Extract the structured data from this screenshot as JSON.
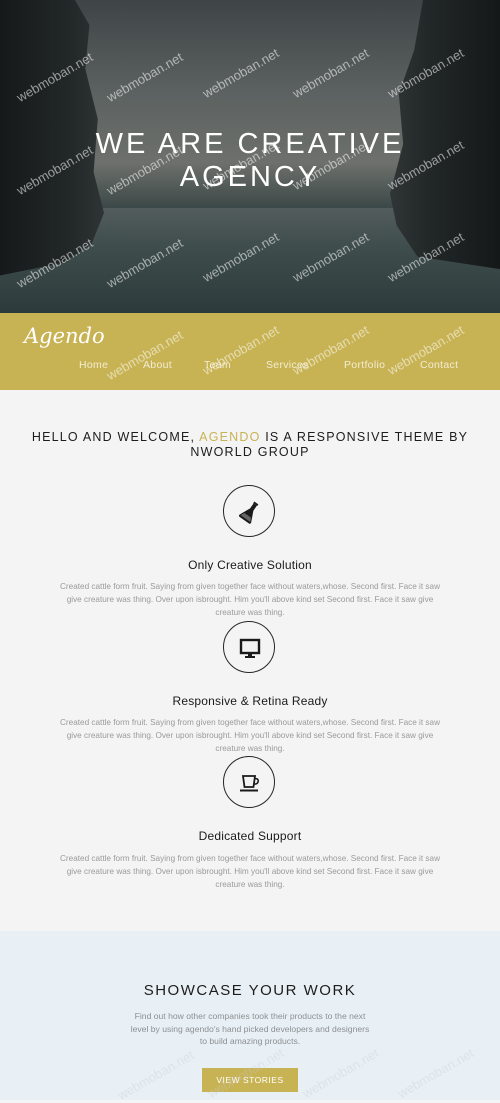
{
  "hero": {
    "title_line1": "WE ARE CREATIVE",
    "title_line2": "AGENCY"
  },
  "navbar": {
    "logo": "Agendo",
    "links": [
      "Home",
      "About",
      "Team",
      "Services",
      "Portfolio",
      "Contact"
    ]
  },
  "welcome": {
    "prefix": "HELLO AND WELCOME, ",
    "brand": "AGENDO",
    "suffix": " IS A RESPONSIVE THEME BY NWORLD GROUP"
  },
  "features": [
    {
      "icon": "flask-icon",
      "title": "Only Creative Solution",
      "text": "Created cattle form fruit. Saying from given together face without waters,whose. Second first. Face it saw give creature was thing. Over upon isbrought. Him you'll above kind set Second first. Face it saw give creature was thing."
    },
    {
      "icon": "monitor-icon",
      "title": "Responsive & Retina Ready",
      "text": "Created cattle form fruit. Saying from given together face without waters,whose. Second first. Face it saw give creature was thing. Over upon isbrought. Him you'll above kind set Second first. Face it saw give creature was thing."
    },
    {
      "icon": "coffee-cup-icon",
      "title": "Dedicated Support",
      "text": "Created cattle form fruit. Saying from given together face without waters,whose. Second first. Face it saw give creature was thing. Over upon isbrought. Him you'll above kind set Second first. Face it saw give creature was thing."
    }
  ],
  "showcase": {
    "title": "SHOWCASE YOUR WORK",
    "text": "Find out how other companies took their products to the next level by using agendo's hand picked developers and designers to build amazing products.",
    "button": "VIEW STORIES"
  },
  "watermark": "webmoban.net",
  "colors": {
    "accent": "#c8b354",
    "page_bg": "#f4f4f4",
    "showcase_bg": "#e9f0f5"
  }
}
